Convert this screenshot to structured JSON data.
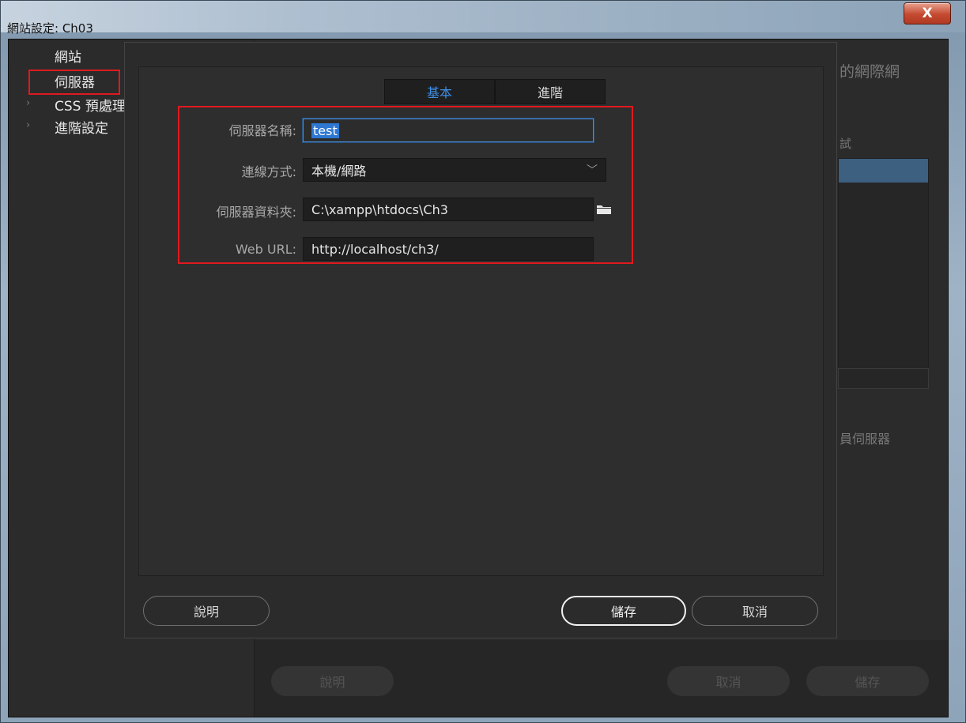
{
  "window": {
    "title": "網站設定: Ch03",
    "close_glyph": "X"
  },
  "background": {
    "sidebar": {
      "items": [
        {
          "label": "網站"
        },
        {
          "label": "伺服器"
        },
        {
          "label": "CSS 預處理"
        },
        {
          "label": "進階設定"
        }
      ]
    },
    "main": {
      "partial_heading": "的網際網",
      "partial_column": "試",
      "partial_option": "員伺服器"
    },
    "buttons": {
      "help": "說明",
      "cancel": "取消",
      "save": "儲存"
    }
  },
  "dialog": {
    "tabs": [
      {
        "label": "基本",
        "active": true
      },
      {
        "label": "進階",
        "active": false
      }
    ],
    "fields": {
      "server_name": {
        "label": "伺服器名稱:",
        "value": "test"
      },
      "connection": {
        "label": "連線方式:",
        "value": "本機/網路"
      },
      "server_folder": {
        "label": "伺服器資料夾:",
        "value": "C:\\xampp\\htdocs\\Ch3"
      },
      "web_url": {
        "label": "Web URL:",
        "value": "http://localhost/ch3/"
      }
    },
    "buttons": {
      "help": "說明",
      "save": "儲存",
      "cancel": "取消"
    }
  },
  "colors": {
    "highlight_box": "#e0191e",
    "active_tab": "#3d8ee6",
    "selection": "#2e78d2"
  },
  "icons": {
    "folder": "folder-icon",
    "dropdown": "chevron-down-icon"
  }
}
